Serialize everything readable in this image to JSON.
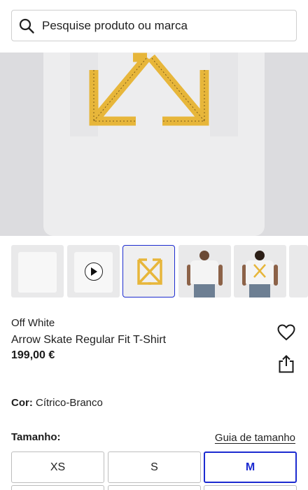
{
  "search": {
    "placeholder": "Pesquise produto ou marca",
    "icon": "search-icon"
  },
  "gallery": {
    "hero_alt": "product image - arrow logo print",
    "thumbnails": [
      {
        "kind": "front-plain"
      },
      {
        "kind": "video",
        "icon": "play-icon"
      },
      {
        "kind": "arrow-print",
        "selected": true
      },
      {
        "kind": "model-front"
      },
      {
        "kind": "model-back"
      },
      {
        "kind": "partial"
      }
    ]
  },
  "product": {
    "brand": "Off White",
    "name": "Arrow Skate Regular Fit T-Shirt",
    "price": "199,00 €"
  },
  "actions": {
    "wishlist_icon": "heart-icon",
    "share_icon": "share-icon"
  },
  "color": {
    "label": "Cor:",
    "value": "Cítrico-Branco"
  },
  "sizes": {
    "title": "Tamanho:",
    "guide_label": "Guia de tamanho",
    "options": [
      "XS",
      "S",
      "M"
    ],
    "selected": "M"
  },
  "colors": {
    "accent": "#1c2bd0",
    "print": "#e7b63a"
  }
}
